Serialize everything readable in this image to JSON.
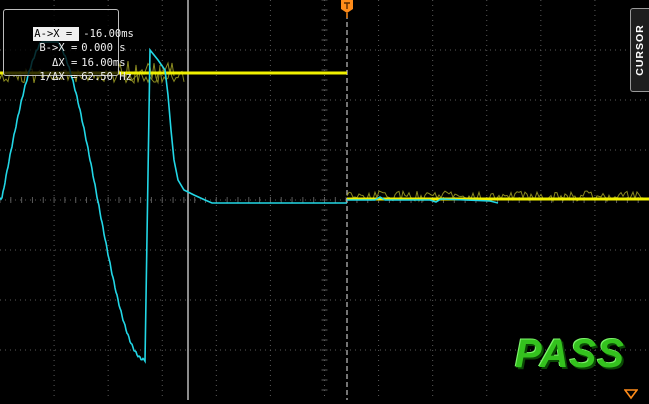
{
  "cursor_readout": {
    "rows": [
      {
        "label": "A->X =",
        "value": "-16.00ms"
      },
      {
        "label": "B->X =",
        "value": "0.000 s"
      },
      {
        "label": "ΔX =",
        "value": "16.00ms"
      },
      {
        "label": "1/ΔX =",
        "value": "62.50 Hz"
      }
    ]
  },
  "cursor_tab": {
    "label": "CURSOR"
  },
  "status": {
    "text": "PASS",
    "color": "#34c21e"
  },
  "colors": {
    "background": "#000000",
    "grid": "#5a5a5a",
    "channel1": "#f0f000",
    "channel2": "#22d7e6",
    "cursor_line": "#e8e8e8",
    "trigger_marker": "#ff8c1a"
  },
  "icons": {
    "trigger_position": "trigger-position-icon",
    "trigger_level": "trigger-level-icon"
  }
}
